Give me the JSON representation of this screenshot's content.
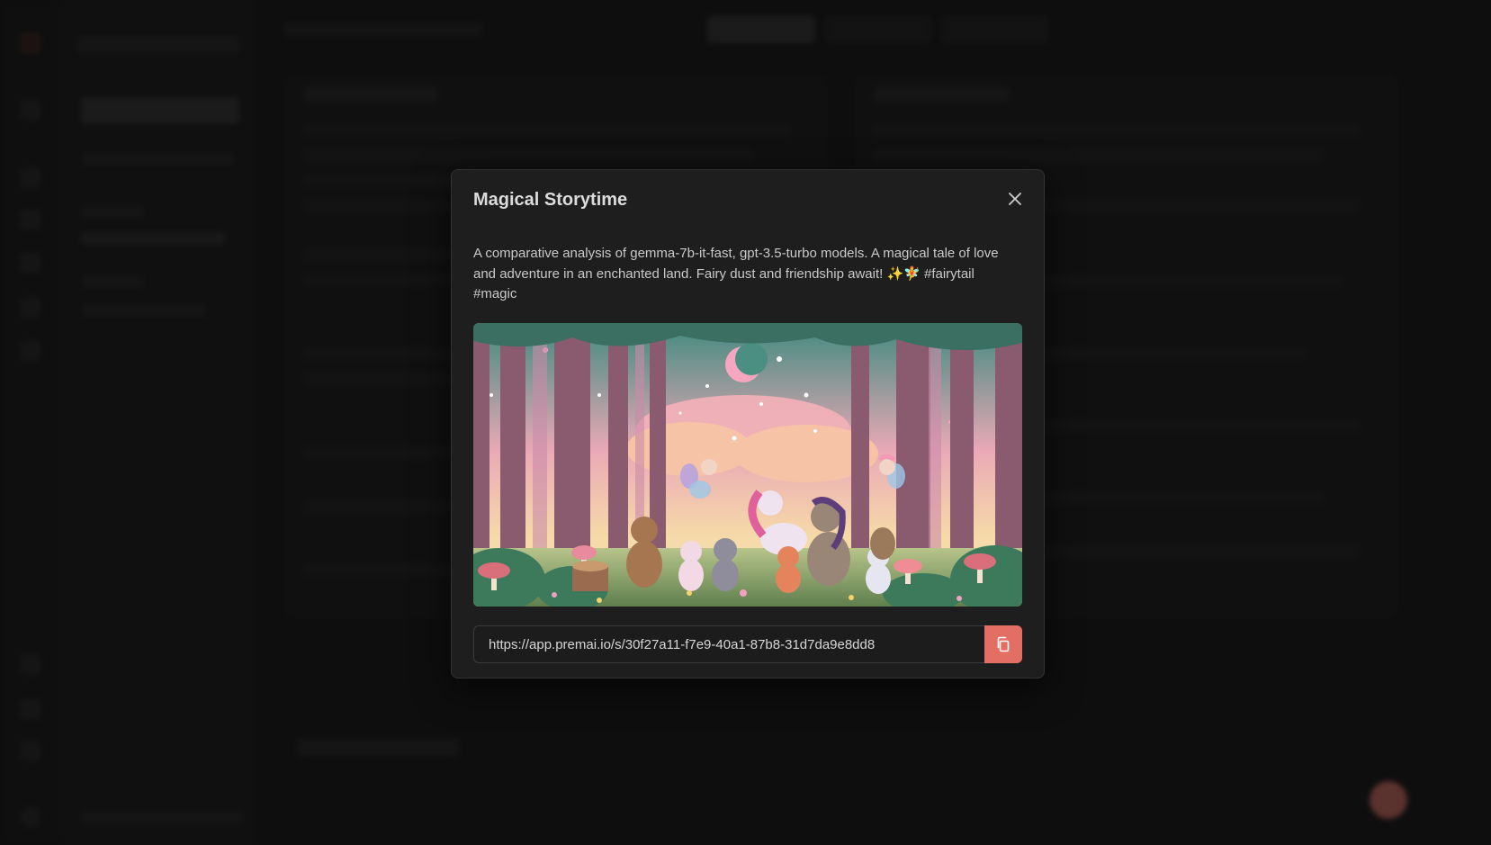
{
  "modal": {
    "title": "Magical Storytime",
    "description": "A comparative analysis of gemma-7b-it-fast, gpt-3.5-turbo models. A magical tale of love and adventure in an enchanted land. Fairy dust and friendship await! ✨🧚 #fairytail #magic",
    "image_icon": "storybook-illustration",
    "share_url": "https://app.premai.io/s/30f27a11-f7e9-40a1-87b8-31d7da9e8dd8",
    "copy_icon": "copy-icon",
    "close_icon": "close-icon"
  },
  "colors": {
    "accent": "#e36e63",
    "modal_bg": "#1e1e1e",
    "backdrop": "#0a0a0a"
  }
}
